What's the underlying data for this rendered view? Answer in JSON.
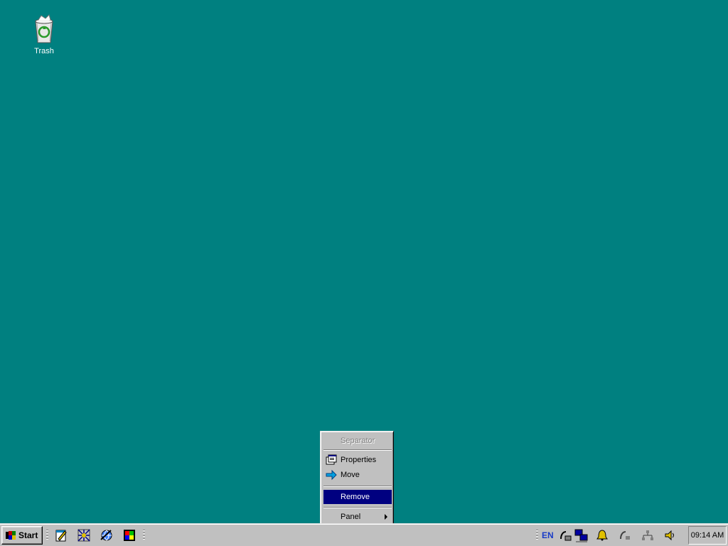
{
  "desktop": {
    "background": "#008080",
    "icons": [
      {
        "label": "Trash",
        "icon": "recycle-bin-icon"
      }
    ]
  },
  "context_menu": {
    "items": [
      {
        "label": "Separator",
        "state": "disabled"
      },
      {
        "label": "Properties",
        "icon": "properties-icon"
      },
      {
        "label": "Move",
        "icon": "move-arrow-icon"
      },
      {
        "label": "Remove",
        "state": "highlighted"
      },
      {
        "label": "Panel",
        "submenu": true
      }
    ]
  },
  "taskbar": {
    "start_label": "Start",
    "quicklaunch": [
      "notepad-icon",
      "network-sparkle-icon",
      "settings-globe-icon",
      "color-palette-icon"
    ],
    "tray": {
      "language": "EN",
      "icons": [
        "modem-icon",
        "network-computers-icon",
        "bell-icon",
        "phone-icon",
        "network-tree-icon",
        "volume-icon"
      ]
    },
    "clock": "09:14 AM"
  }
}
